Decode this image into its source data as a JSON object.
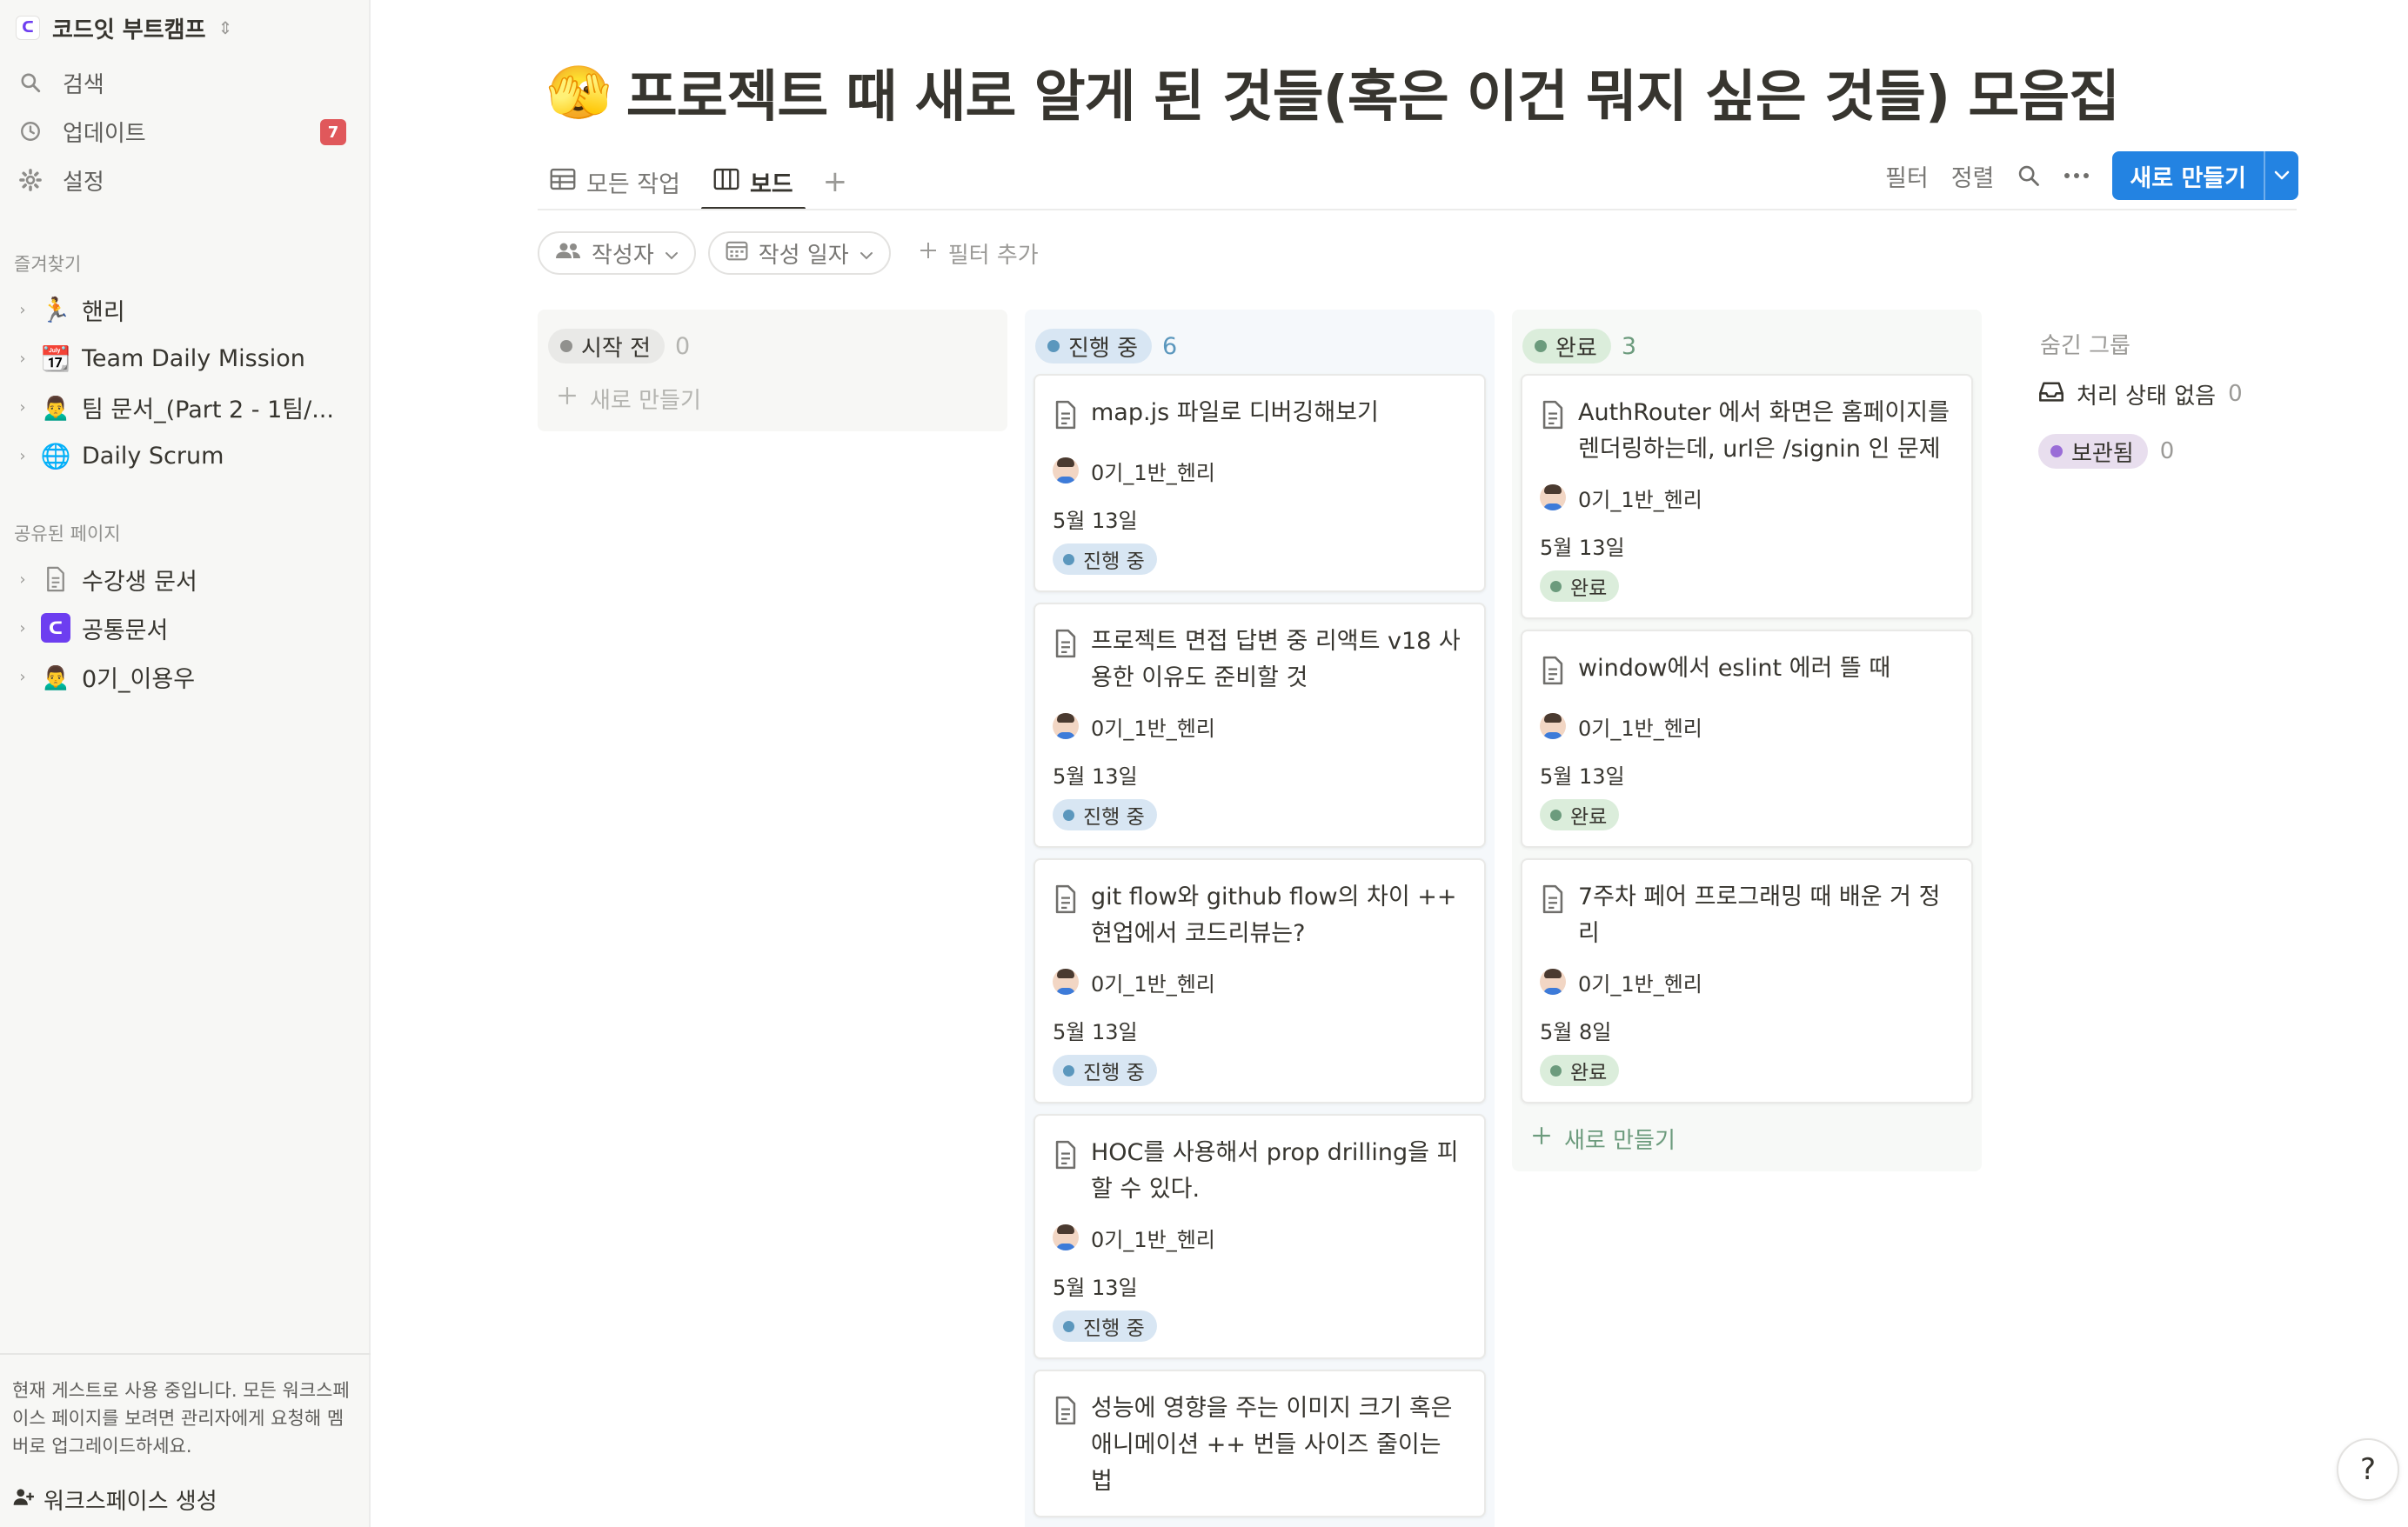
{
  "sidebar": {
    "workspace_name": "코드잇 부트캠프",
    "workspace_logo": "ᑕ",
    "nav": [
      {
        "label": "검색",
        "icon": "search-icon"
      },
      {
        "label": "업데이트",
        "icon": "clock-icon",
        "badge": "7"
      },
      {
        "label": "설정",
        "icon": "gear-icon"
      }
    ],
    "favorites_label": "즐겨찾기",
    "favorites": [
      {
        "label": "핸리",
        "emoji": "🏃"
      },
      {
        "label": "Team Daily Mission",
        "emoji": "📆"
      },
      {
        "label": "팀 문서_(Part 2 - 1팀/...",
        "emoji": "🙍‍♂️"
      },
      {
        "label": "Daily Scrum",
        "emoji": "🌐"
      }
    ],
    "shared_label": "공유된 페이지",
    "shared": [
      {
        "label": "수강생 문서",
        "icon": "page-icon"
      },
      {
        "label": "공통문서",
        "icon": "codeit-logo-icon",
        "logo": "ᑕ"
      },
      {
        "label": "0기_이용우",
        "emoji": "🙍‍♂️"
      }
    ],
    "guest_note": "현재 게스트로 사용 중입니다. 모든 워크스페이스 페이지를 보려면 관리자에게 요청해 멤버로 업그레이드하세요.",
    "create_workspace": "워크스페이스 생성"
  },
  "page": {
    "emoji": "🫣",
    "title": "프로젝트 때 새로 알게 된 것들(혹은 이건 뭐지 싶은 것들) 모음집"
  },
  "views": {
    "tabs": [
      {
        "label": "모든 작업",
        "icon": "table-icon"
      },
      {
        "label": "보드",
        "icon": "board-icon",
        "active": true
      }
    ],
    "add_label": "+"
  },
  "toolbar": {
    "filter_label": "필터",
    "sort_label": "정렬",
    "new_label": "새로 만들기"
  },
  "filters": {
    "chips": [
      {
        "label": "작성자",
        "icon": "people-icon"
      },
      {
        "label": "작성 일자",
        "icon": "calendar-icon"
      }
    ],
    "add_filter": "필터 추가"
  },
  "board": {
    "columns": [
      {
        "status": "시작 전",
        "count": "0",
        "colors": {
          "bg": "#f7f7f5",
          "pill": "#e9e9e7",
          "dot": "#91918e",
          "count": "#b4b4b0",
          "new": "#b4b4b0"
        },
        "cards": [],
        "new_label": "새로 만들기"
      },
      {
        "status": "진행 중",
        "count": "6",
        "colors": {
          "bg": "#f5f8fb",
          "pill": "#d8e6f3",
          "dot": "#5b97bd",
          "count": "#5b97bd",
          "new": "#5b97bd"
        },
        "cards": [
          {
            "title": "map.js 파일로 디버깅해보기",
            "author": "0기_1반_헨리",
            "date": "5월 13일",
            "tag": "진행 중"
          },
          {
            "title": "프로젝트 면접 답변 중 리액트 v18 사용한 이유도 준비할 것",
            "author": "0기_1반_헨리",
            "date": "5월 13일",
            "tag": "진행 중"
          },
          {
            "title": "git flow와 github flow의 차이 ++ 현업에서 코드리뷰는?",
            "author": "0기_1반_헨리",
            "date": "5월 13일",
            "tag": "진행 중"
          },
          {
            "title": "HOC를 사용해서 prop drilling을 피할 수 있다.",
            "author": "0기_1반_헨리",
            "date": "5월 13일",
            "tag": "진행 중"
          },
          {
            "title": "성능에 영향을 주는 이미지 크기 혹은 애니메이션 ++ 번들 사이즈 줄이는 법",
            "author": "",
            "date": "",
            "tag": ""
          }
        ]
      },
      {
        "status": "완료",
        "count": "3",
        "colors": {
          "bg": "#f7f9f7",
          "pill": "#dbeddb",
          "dot": "#6c9b7d",
          "count": "#6c9b7d",
          "new": "#6c9b7d"
        },
        "cards": [
          {
            "title": "AuthRouter 에서 화면은 홈페이지를 렌더링하는데, url은 /signin 인 문제",
            "author": "0기_1반_헨리",
            "date": "5월 13일",
            "tag": "완료"
          },
          {
            "title": "window에서 eslint 에러 뜰 때",
            "author": "0기_1반_헨리",
            "date": "5월 13일",
            "tag": "완료"
          },
          {
            "title": "7주차 페어 프로그래밍 때 배운 거 정리",
            "author": "0기_1반_헨리",
            "date": "5월 8일",
            "tag": "완료"
          }
        ],
        "new_label": "새로 만들기"
      }
    ],
    "hidden_groups_label": "숨긴 그룹",
    "hidden_groups": [
      {
        "label": "처리 상태 없음",
        "count": "0",
        "icon": "inbox-icon"
      },
      {
        "label": "보관됨",
        "count": "0",
        "pill_color": "#e8deee",
        "dot_color": "#9a6dd7"
      }
    ]
  },
  "help_label": "?"
}
